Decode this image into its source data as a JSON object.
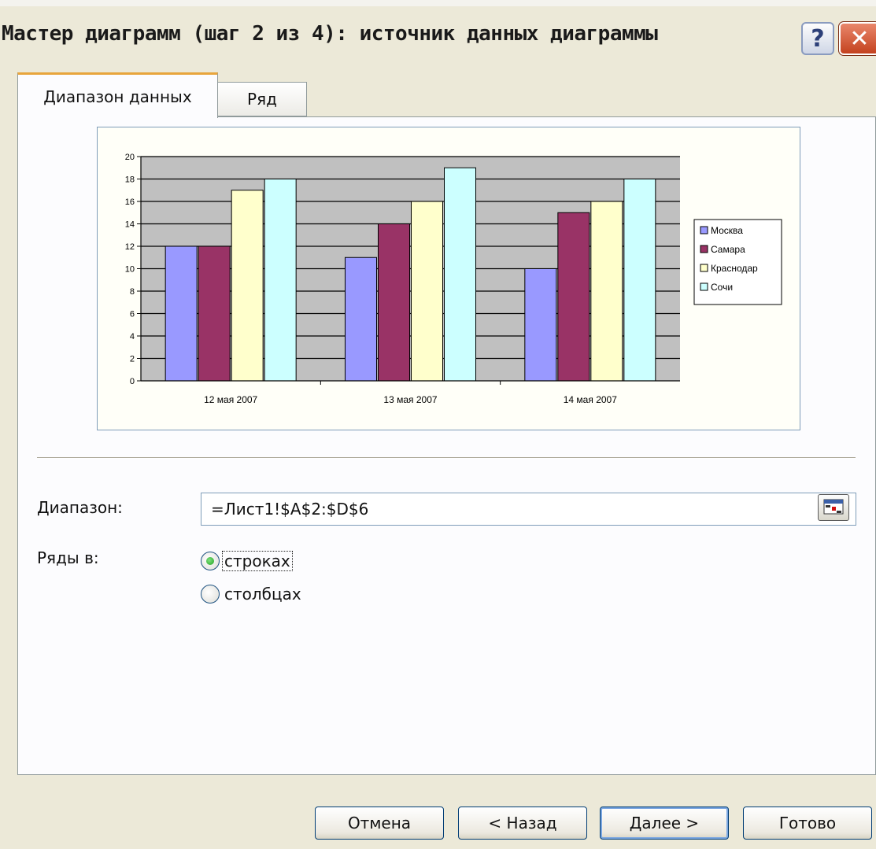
{
  "window": {
    "title": "Мастер диаграмм (шаг 2 из 4): источник данных диаграммы",
    "help_label": "?",
    "close_label": "✕"
  },
  "tabs": [
    {
      "label": "Диапазон данных",
      "active": true
    },
    {
      "label": "Ряд",
      "active": false
    }
  ],
  "form": {
    "range_label": "Диапазон:",
    "range_value": "=Лист1!$A$2:$D$6",
    "series_in_label": "Ряды в:",
    "options": [
      {
        "label": "строках",
        "checked": true
      },
      {
        "label": "столбцах",
        "checked": false
      }
    ]
  },
  "buttons": {
    "cancel": "Отмена",
    "back": "< Назад",
    "next": "Далее >",
    "finish": "Готово"
  },
  "chart_data": {
    "type": "bar",
    "categories": [
      "12 мая 2007",
      "13 мая 2007",
      "14 мая 2007"
    ],
    "series": [
      {
        "name": "Москва",
        "values": [
          12,
          11,
          10
        ],
        "color": "#9999ff"
      },
      {
        "name": "Самара",
        "values": [
          12,
          14,
          15
        ],
        "color": "#993366"
      },
      {
        "name": "Краснодар",
        "values": [
          17,
          16,
          16
        ],
        "color": "#ffffcc"
      },
      {
        "name": "Сочи",
        "values": [
          18,
          19,
          18
        ],
        "color": "#ccffff"
      }
    ],
    "ylim": [
      0,
      20
    ],
    "yticks": [
      0,
      2,
      4,
      6,
      8,
      10,
      12,
      14,
      16,
      18,
      20
    ],
    "plot_background": "#c0c0c0",
    "grid": true,
    "legend_position": "right"
  }
}
